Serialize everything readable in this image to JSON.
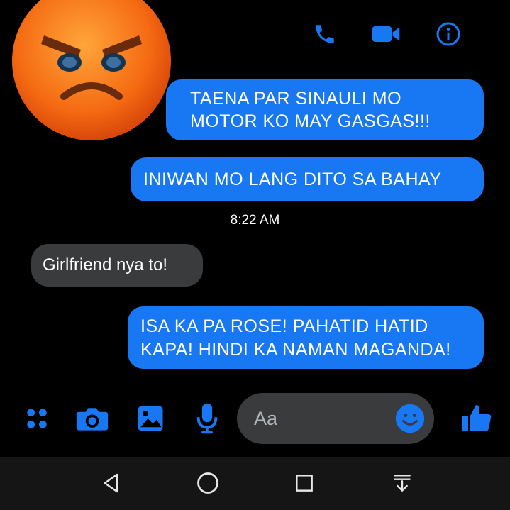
{
  "chat": {
    "messages": [
      {
        "direction": "outgoing",
        "lines": [
          "TAENA PAR SINAULI MO",
          "MOTOR KO MAY GASGAS!!!"
        ]
      },
      {
        "direction": "outgoing",
        "lines": [
          "INIWAN MO LANG DITO SA BAHAY"
        ]
      },
      {
        "direction": "incoming",
        "lines": [
          "Girlfriend nya to!"
        ]
      },
      {
        "direction": "outgoing",
        "lines": [
          "ISA KA PA ROSE! PAHATID HATID",
          "KAPA! HINDI KA NAMAN MAGANDA!"
        ]
      }
    ],
    "timestamp": "8:22 AM"
  },
  "composer": {
    "placeholder": "Aa"
  },
  "icons": {
    "header": [
      "phone-icon",
      "video-camera-icon",
      "info-icon"
    ],
    "toolbar": [
      "apps-icon",
      "camera-icon",
      "gallery-icon",
      "microphone-icon",
      "emoji-icon",
      "thumbs-up-icon"
    ],
    "nav": [
      "back-icon",
      "home-icon",
      "recents-icon",
      "notification-pull-icon"
    ],
    "overlay": "angry-face-emoji"
  },
  "colors": {
    "accent": "#1877f2",
    "background": "#000000",
    "incoming_bubble": "#3a3b3c",
    "emoji_orange": "#f47a1c"
  }
}
